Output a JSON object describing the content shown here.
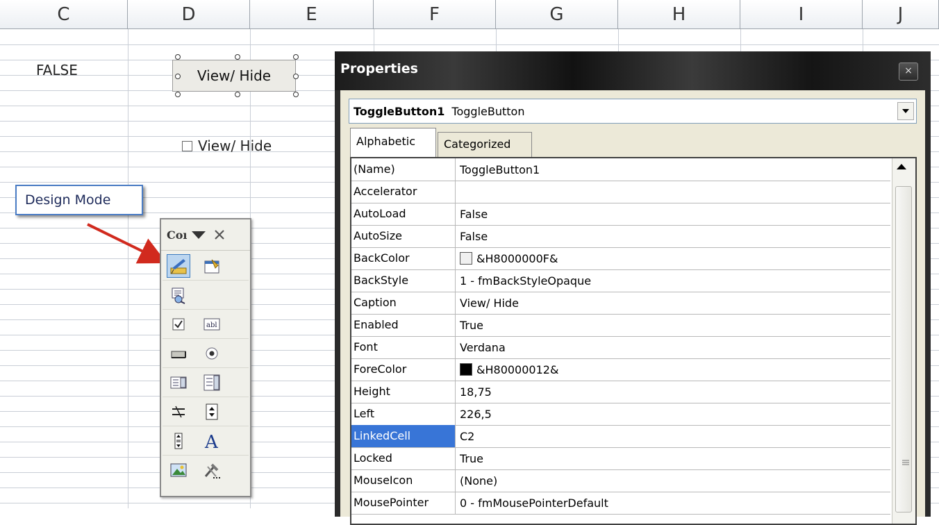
{
  "sheet": {
    "columns": [
      "C",
      "D",
      "E",
      "F",
      "G",
      "H",
      "I",
      "J"
    ],
    "cell_value": "FALSE",
    "toggle_button_caption": "View/ Hide",
    "checkbox_caption": "View/ Hide"
  },
  "callout": {
    "text": "Design Mode"
  },
  "toolbox": {
    "title": "Coı",
    "tools": [
      "design-mode",
      "properties",
      "view-code",
      "check-box",
      "text-box",
      "command-button",
      "option-button",
      "list-box",
      "combo-box",
      "toggle-button",
      "spin-button",
      "scroll-bar",
      "label",
      "image",
      "more-controls"
    ]
  },
  "properties": {
    "title": "Properties",
    "close_label": "×",
    "object_name": "ToggleButton1",
    "object_type": "ToggleButton",
    "tabs": [
      "Alphabetic",
      "Categorized"
    ],
    "rows": [
      {
        "name": "(Name)",
        "value": "ToggleButton1"
      },
      {
        "name": "Accelerator",
        "value": ""
      },
      {
        "name": "AutoLoad",
        "value": "False"
      },
      {
        "name": "AutoSize",
        "value": "False"
      },
      {
        "name": "BackColor",
        "value": "&H8000000F&",
        "swatch": "#f0f0f0"
      },
      {
        "name": "BackStyle",
        "value": "1 - fmBackStyleOpaque"
      },
      {
        "name": "Caption",
        "value": "View/ Hide"
      },
      {
        "name": "Enabled",
        "value": "True"
      },
      {
        "name": "Font",
        "value": "Verdana"
      },
      {
        "name": "ForeColor",
        "value": "&H80000012&",
        "swatch": "#000000"
      },
      {
        "name": "Height",
        "value": "18,75"
      },
      {
        "name": "Left",
        "value": "226,5"
      },
      {
        "name": "LinkedCell",
        "value": "C2",
        "selected": true
      },
      {
        "name": "Locked",
        "value": "True"
      },
      {
        "name": "MouseIcon",
        "value": "(None)"
      },
      {
        "name": "MousePointer",
        "value": "0 - fmMousePointerDefault"
      }
    ]
  },
  "colors": {
    "selection": "#3875d7",
    "callout_border": "#4a7cc4",
    "arrow": "#d12a1e"
  }
}
